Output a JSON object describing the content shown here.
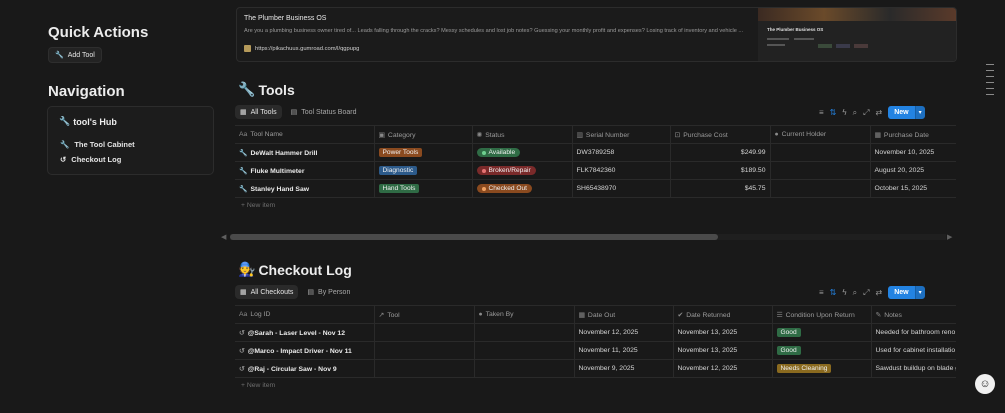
{
  "quick_actions": {
    "title": "Quick Actions",
    "add_tool": "Add Tool"
  },
  "navigation": {
    "title": "Navigation",
    "hub_title": "tool's Hub",
    "links": [
      "The Tool Cabinet",
      "Checkout Log"
    ]
  },
  "bookmark": {
    "title": "The Plumber Business OS",
    "description": "Are you a plumbing business owner tired of... Leads falling through the cracks? Messy schedules and lost job notes? Guessing your monthly profit and expenses? Losing track of inventory and vehicle ...",
    "url": "https://pikachuus.gumroad.com/l/qgpupg",
    "thumb_title": "The Plumber Business OS"
  },
  "tools": {
    "title": "Tools",
    "views": [
      "All Tools",
      "Tool Status Board"
    ],
    "new_label": "New",
    "columns": [
      "Tool Name",
      "Category",
      "Status",
      "Serial Number",
      "Purchase Cost",
      "Current Holder",
      "Purchase Date"
    ],
    "rows": [
      {
        "name": "DeWalt Hammer Drill",
        "category": "Power Tools",
        "status": "Available",
        "serial": "DW3789258",
        "cost": "$249.99",
        "holder": "",
        "date": "November 10, 2025"
      },
      {
        "name": "Fluke Multimeter",
        "category": "Diagnostic",
        "status": "Broken/Repair",
        "serial": "FLK7842360",
        "cost": "$189.50",
        "holder": "",
        "date": "August 20, 2025"
      },
      {
        "name": "Stanley Hand Saw",
        "category": "Hand Tools",
        "status": "Checked Out",
        "serial": "SH65438970",
        "cost": "$45.75",
        "holder": "",
        "date": "October 15, 2025"
      }
    ],
    "new_item": "New item"
  },
  "checkout": {
    "title": "Checkout Log",
    "views": [
      "All Checkouts",
      "By Person"
    ],
    "new_label": "New",
    "columns": [
      "Log ID",
      "Tool",
      "Taken By",
      "Date Out",
      "Date Returned",
      "Condition Upon Return",
      "Notes"
    ],
    "rows": [
      {
        "id": "@Sarah - Laser Level - Nov 12",
        "tool": "",
        "taken": "",
        "out": "November 12, 2025",
        "returned": "November 13, 2025",
        "condition": "Good",
        "notes": "Needed for bathroom reno"
      },
      {
        "id": "@Marco - Impact Driver - Nov 11",
        "tool": "",
        "taken": "",
        "out": "November 11, 2025",
        "returned": "November 13, 2025",
        "condition": "Good",
        "notes": "Used for cabinet installatio"
      },
      {
        "id": "@Raj - Circular Saw - Nov 9",
        "tool": "",
        "taken": "",
        "out": "November 9, 2025",
        "returned": "November 12, 2025",
        "condition": "Needs Cleaning",
        "notes": "Sawdust buildup on blade g"
      }
    ],
    "new_item": "New item"
  },
  "colors": {
    "accent": "#2383e2",
    "tag_power": "#8a4a1f",
    "tag_diag": "#2c5a8a",
    "tag_hand": "#2f6b45",
    "status_available": "#2f6b45",
    "status_broken": "#7a2a2a",
    "status_checked": "#8a4a1f",
    "cond_good": "#2f6b45",
    "cond_clean": "#8a6a1f"
  }
}
